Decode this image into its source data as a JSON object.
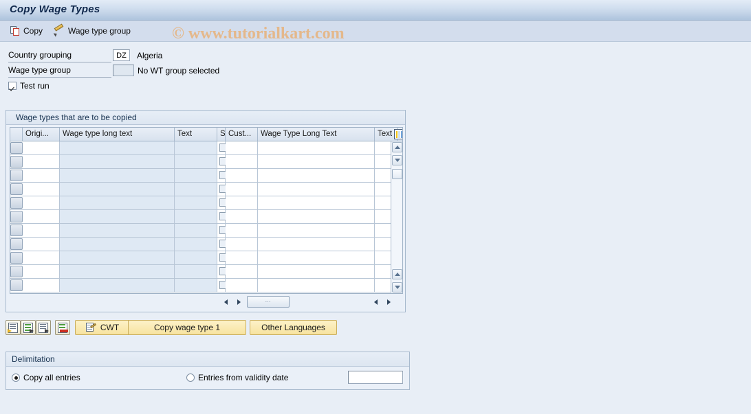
{
  "window": {
    "title": "Copy Wage Types"
  },
  "toolbar": {
    "copy_label": "Copy",
    "wage_type_group_label": "Wage type group"
  },
  "watermark": {
    "text": "© www.tutorialkart.com"
  },
  "form": {
    "country_grouping_label": "Country grouping",
    "country_grouping_value": "DZ",
    "country_grouping_text": "Algeria",
    "wage_type_group_label": "Wage type group",
    "wage_type_group_value": "",
    "wage_type_group_text": "No WT group selected",
    "test_run_label": "Test run",
    "test_run_checked": true
  },
  "table": {
    "caption": "Wage types that are to be copied",
    "columns": [
      "Origi...",
      "Wage type long text",
      "Text",
      "S",
      "Cust...",
      "Wage Type Long Text",
      "Text"
    ],
    "config_icon": "table-settings-icon",
    "row_count": 11,
    "rows": [
      {
        "origin": "",
        "wage_type_long_text": "",
        "text": "",
        "s": false,
        "cust": "",
        "wage_type_long_text_2": "",
        "text_2": ""
      },
      {
        "origin": "",
        "wage_type_long_text": "",
        "text": "",
        "s": false,
        "cust": "",
        "wage_type_long_text_2": "",
        "text_2": ""
      },
      {
        "origin": "",
        "wage_type_long_text": "",
        "text": "",
        "s": false,
        "cust": "",
        "wage_type_long_text_2": "",
        "text_2": ""
      },
      {
        "origin": "",
        "wage_type_long_text": "",
        "text": "",
        "s": false,
        "cust": "",
        "wage_type_long_text_2": "",
        "text_2": ""
      },
      {
        "origin": "",
        "wage_type_long_text": "",
        "text": "",
        "s": false,
        "cust": "",
        "wage_type_long_text_2": "",
        "text_2": ""
      },
      {
        "origin": "",
        "wage_type_long_text": "",
        "text": "",
        "s": false,
        "cust": "",
        "wage_type_long_text_2": "",
        "text_2": ""
      },
      {
        "origin": "",
        "wage_type_long_text": "",
        "text": "",
        "s": false,
        "cust": "",
        "wage_type_long_text_2": "",
        "text_2": ""
      },
      {
        "origin": "",
        "wage_type_long_text": "",
        "text": "",
        "s": false,
        "cust": "",
        "wage_type_long_text_2": "",
        "text_2": ""
      },
      {
        "origin": "",
        "wage_type_long_text": "",
        "text": "",
        "s": false,
        "cust": "",
        "wage_type_long_text_2": "",
        "text_2": ""
      },
      {
        "origin": "",
        "wage_type_long_text": "",
        "text": "",
        "s": false,
        "cust": "",
        "wage_type_long_text_2": "",
        "text_2": ""
      },
      {
        "origin": "",
        "wage_type_long_text": "",
        "text": "",
        "s": false,
        "cust": "",
        "wage_type_long_text_2": "",
        "text_2": ""
      }
    ]
  },
  "actions": {
    "icons": [
      "insert-row-icon",
      "copy-row-icon",
      "select-all-rows-icon",
      "delete-row-icon"
    ],
    "cwt_label": "CWT",
    "copy_wage_type_label": "Copy wage type 1",
    "other_languages_label": "Other Languages"
  },
  "delimitation": {
    "caption": "Delimitation",
    "copy_all_label": "Copy all entries",
    "copy_all_selected": true,
    "from_date_label": "Entries from validity date",
    "from_date_selected": false,
    "from_date_value": ""
  },
  "colors": {
    "title_bar": "#aec4dd",
    "toolbar": "#d3dded",
    "page_background": "#e8eef6",
    "button_yellow": "#f7e3a0",
    "watermark": "#e8b27a",
    "readonly_cell": "#dfe9f4"
  }
}
